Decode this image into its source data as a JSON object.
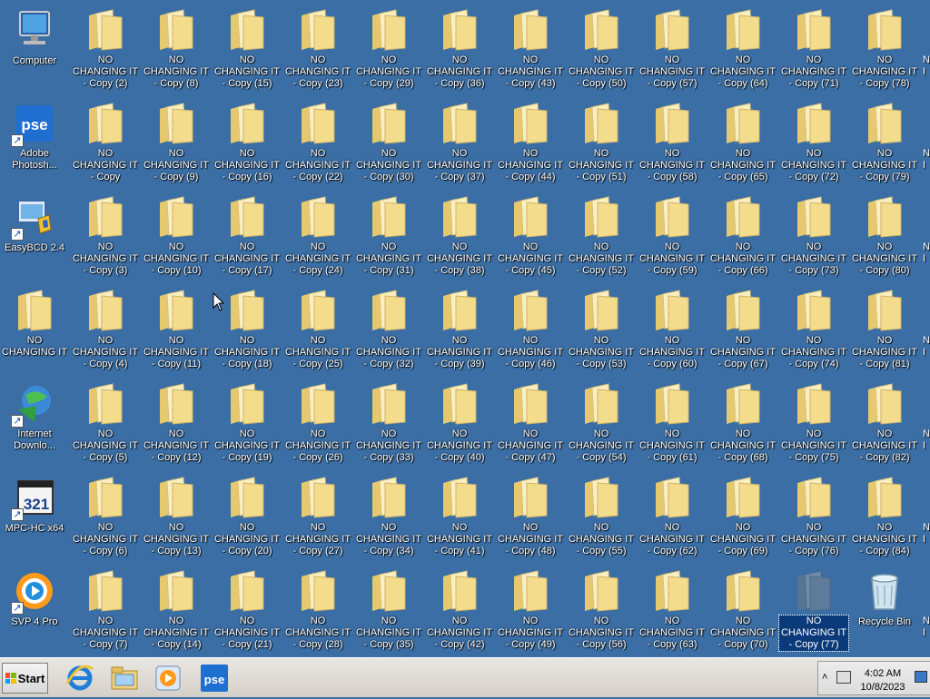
{
  "desktop": {
    "computer": "Computer",
    "adobe": "Adobe Photosh...",
    "easybcd": "EasyBCD 2.4",
    "nochanging": "NO CHANGING IT",
    "idm": "Internet Downlo...",
    "mpc": "MPC-HC x64",
    "svp": "SVP 4 Pro",
    "recycle": "Recycle Bin",
    "folders": [
      [
        "NO CHANGING IT - Copy (2)",
        "NO CHANGING IT - Copy (8)",
        "NO CHANGING IT - Copy (15)",
        "NO CHANGING IT - Copy (23)",
        "NO CHANGING IT - Copy (29)",
        "NO CHANGING IT - Copy (36)",
        "NO CHANGING IT - Copy (43)",
        "NO CHANGING IT - Copy (50)",
        "NO CHANGING IT - Copy (57)",
        "NO CHANGING IT - Copy (64)",
        "NO CHANGING IT - Copy (71)",
        "NO CHANGING IT - Copy (78)"
      ],
      [
        "NO CHANGING IT - Copy",
        "NO CHANGING IT - Copy (9)",
        "NO CHANGING IT - Copy (16)",
        "NO CHANGING IT - Copy (22)",
        "NO CHANGING IT - Copy (30)",
        "NO CHANGING IT - Copy (37)",
        "NO CHANGING IT - Copy (44)",
        "NO CHANGING IT - Copy (51)",
        "NO CHANGING IT - Copy (58)",
        "NO CHANGING IT - Copy (65)",
        "NO CHANGING IT - Copy (72)",
        "NO CHANGING IT - Copy (79)"
      ],
      [
        "NO CHANGING IT - Copy (3)",
        "NO CHANGING IT - Copy (10)",
        "NO CHANGING IT - Copy (17)",
        "NO CHANGING IT - Copy (24)",
        "NO CHANGING IT - Copy (31)",
        "NO CHANGING IT - Copy (38)",
        "NO CHANGING IT - Copy (45)",
        "NO CHANGING IT - Copy (52)",
        "NO CHANGING IT - Copy (59)",
        "NO CHANGING IT - Copy (66)",
        "NO CHANGING IT - Copy (73)",
        "NO CHANGING IT - Copy (80)"
      ],
      [
        "NO CHANGING IT - Copy (4)",
        "NO CHANGING IT - Copy (11)",
        "NO CHANGING IT - Copy (18)",
        "NO CHANGING IT - Copy (25)",
        "NO CHANGING IT - Copy (32)",
        "NO CHANGING IT - Copy (39)",
        "NO CHANGING IT - Copy (46)",
        "NO CHANGING IT - Copy (53)",
        "NO CHANGING IT - Copy (60)",
        "NO CHANGING IT - Copy (67)",
        "NO CHANGING IT - Copy (74)",
        "NO CHANGING IT - Copy (81)"
      ],
      [
        "NO CHANGING IT - Copy (5)",
        "NO CHANGING IT - Copy (12)",
        "NO CHANGING IT - Copy (19)",
        "NO CHANGING IT - Copy (26)",
        "NO CHANGING IT - Copy (33)",
        "NO CHANGING IT - Copy (40)",
        "NO CHANGING IT - Copy (47)",
        "NO CHANGING IT - Copy (54)",
        "NO CHANGING IT - Copy (61)",
        "NO CHANGING IT - Copy (68)",
        "NO CHANGING IT - Copy (75)",
        "NO CHANGING IT - Copy (82)"
      ],
      [
        "NO CHANGING IT - Copy (6)",
        "NO CHANGING IT - Copy (13)",
        "NO CHANGING IT - Copy (20)",
        "NO CHANGING IT - Copy (27)",
        "NO CHANGING IT - Copy (34)",
        "NO CHANGING IT - Copy (41)",
        "NO CHANGING IT - Copy (48)",
        "NO CHANGING IT - Copy (55)",
        "NO CHANGING IT - Copy (62)",
        "NO CHANGING IT - Copy (69)",
        "NO CHANGING IT - Copy (76)",
        "NO CHANGING IT - Copy (84)"
      ],
      [
        "NO CHANGING IT - Copy (7)",
        "NO CHANGING IT - Copy (14)",
        "NO CHANGING IT - Copy (21)",
        "NO CHANGING IT - Copy (28)",
        "NO CHANGING IT - Copy (35)",
        "NO CHANGING IT - Copy (42)",
        "NO CHANGING IT - Copy (49)",
        "NO CHANGING IT - Copy (56)",
        "NO CHANGING IT - Copy (63)",
        "NO CHANGING IT - Copy (70)",
        "NO CHANGING IT - Copy (77)"
      ]
    ],
    "partial_label": "N I",
    "selected_folder": "NO CHANGING IT - Copy (77)"
  },
  "taskbar": {
    "start_label": "Start",
    "pinned": [
      "internet-explorer-icon",
      "windows-explorer-icon",
      "media-player-icon",
      "photoshop-elements-icon"
    ],
    "clock_time": "4:02 AM",
    "clock_date": "10/8/2023"
  },
  "colors": {
    "desktop": "#3a6ea5",
    "folder": "#f3dc8c",
    "selection": "#0b3a7a"
  }
}
